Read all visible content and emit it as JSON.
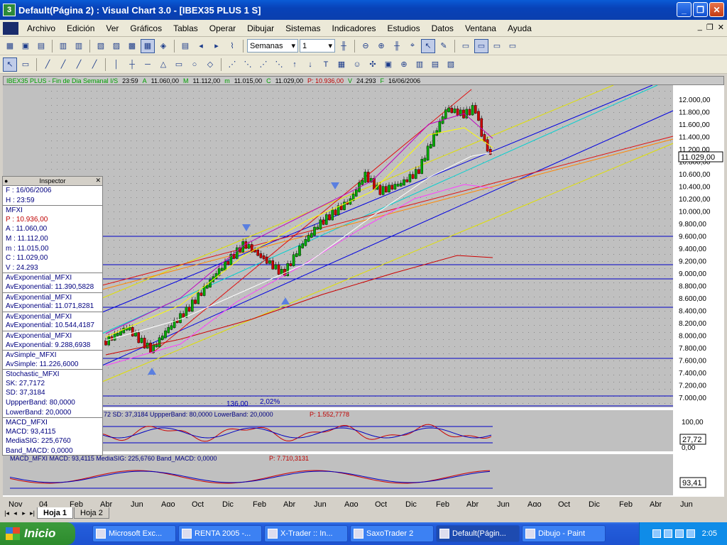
{
  "window": {
    "title": "Default(Página 2) : Visual Chart  3.0 - [IBEX35 PLUS 1 S]",
    "app_icon": "3"
  },
  "menu": [
    "Archivo",
    "Edición",
    "Ver",
    "Gráficos",
    "Tablas",
    "Operar",
    "Dibujar",
    "Sistemas",
    "Indicadores",
    "Estudios",
    "Datos",
    "Ventana",
    "Ayuda"
  ],
  "toolbar": {
    "period_value": "Semanas",
    "multiplier_value": "1"
  },
  "info_bar": {
    "symbol": "IBEX35 PLUS - Fin de Dia Semanal I/S",
    "time": "23:59",
    "open": "11.060,00",
    "high": "11.112,00",
    "low": "11.015,00",
    "close": "11.029,00",
    "prev_label": "P: 10.936,00",
    "volume": "24.293",
    "date": "16/06/2006"
  },
  "price_axis": {
    "labels": [
      "12.000,00",
      "11.800,00",
      "11.600,00",
      "11.400,00",
      "11.200,00",
      "10.800,00",
      "10.600,00",
      "10.400,00",
      "10.200,00",
      "10.000,00",
      "9.800,00",
      "9.600,00",
      "9.400,00",
      "9.200,00",
      "9.000,00",
      "8.800,00",
      "8.600,00",
      "8.400,00",
      "8.200,00",
      "8.000,00",
      "7.800,00",
      "7.600,00",
      "7.400,00",
      "7.200,00",
      "7.000,00"
    ],
    "last_price": "11.029,00"
  },
  "annotations": {
    "distance": "136,00",
    "pct": "2,02%"
  },
  "stoch_panel": {
    "header": "72 SD: 37,3184  UppperBand: 80,0000  LowerBand: 20,0000",
    "prev": "P: 1.552,7778",
    "axis": [
      "100,00",
      "0,00"
    ],
    "last": "27,72"
  },
  "macd_panel": {
    "header": "MACD_MFXI  MACD: 93,4115  MediaSIG: 225,6760  Band_MACD: 0,0000",
    "prev": "P: 7.710,3131",
    "last": "93,41"
  },
  "time_axis": [
    "Nov",
    "04",
    "Feb",
    "Abr",
    "Jun",
    "Ago",
    "Oct",
    "Dic",
    "Feb",
    "Abr",
    "Jun",
    "Ago",
    "Oct",
    "Dic",
    "Feb",
    "Abr",
    "Jun",
    "Ago",
    "Oct",
    "Dic",
    "Feb",
    "Abr",
    "Jun"
  ],
  "inspector": {
    "title": "Inspector",
    "rows": [
      {
        "t": "F : 16/06/2006",
        "c": "n"
      },
      {
        "t": "H : 23:59",
        "c": "n"
      },
      {
        "t": "MFXI",
        "c": "s"
      },
      {
        "t": "P : 10.936,00",
        "c": "r"
      },
      {
        "t": "A : 11.060,00",
        "c": "n"
      },
      {
        "t": "M : 11.112,00",
        "c": "n"
      },
      {
        "t": "m : 11.015,00",
        "c": "n"
      },
      {
        "t": "C : 11.029,00",
        "c": "n"
      },
      {
        "t": "V : 24.293",
        "c": "n"
      },
      {
        "t": "AvExponential_MFXI",
        "c": "s"
      },
      {
        "t": "AvExponential: 11.390,5828",
        "c": "n"
      },
      {
        "t": "AvExponential_MFXI",
        "c": "s"
      },
      {
        "t": "AvExponential: 11.071,8281",
        "c": "n"
      },
      {
        "t": "AvExponential_MFXI",
        "c": "s"
      },
      {
        "t": "AvExponential: 10.544,4187",
        "c": "n"
      },
      {
        "t": "AvExponential_MFXI",
        "c": "s"
      },
      {
        "t": "AvExponential: 9.288,6938",
        "c": "n"
      },
      {
        "t": "AvSimple_MFXI",
        "c": "s"
      },
      {
        "t": "AvSimple: 11.226,6000",
        "c": "n"
      },
      {
        "t": "Stochastic_MFXI",
        "c": "s"
      },
      {
        "t": "SK: 27,7172",
        "c": "n"
      },
      {
        "t": "SD: 37,3184",
        "c": "n"
      },
      {
        "t": "UppperBand: 80,0000",
        "c": "n"
      },
      {
        "t": "LowerBand: 20,0000",
        "c": "n"
      },
      {
        "t": "MACD_MFXI",
        "c": "s"
      },
      {
        "t": "MACD: 93,4115",
        "c": "n"
      },
      {
        "t": "MediaSIG: 225,6760",
        "c": "n"
      },
      {
        "t": "Band_MACD: 0,0000",
        "c": "n"
      }
    ]
  },
  "sheet_tabs": [
    "Hoja 1",
    "Hoja 2"
  ],
  "taskbar": {
    "start": "Inicio",
    "tasks": [
      "Microsoft Exc...",
      "RENTA 2005 -...",
      "X-Trader :: In...",
      "SaxoTrader 2",
      "Default(Págin...",
      "Dibujo - Paint"
    ],
    "active_task": 4,
    "clock": "2:05"
  },
  "colors": {
    "chart_bg": "#c0c0c0",
    "up": "#00aa00",
    "down": "#cc0000",
    "band": "#0000c8"
  }
}
